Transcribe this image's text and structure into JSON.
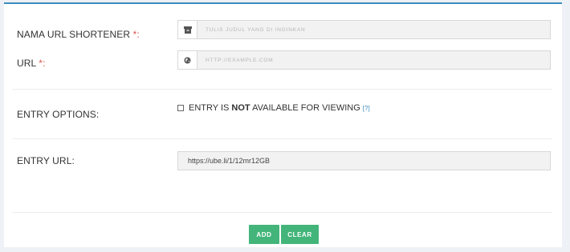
{
  "form": {
    "name_label": "NAMA URL SHORTENER ",
    "name_required": "*:",
    "name_placeholder": "TULIS JUDUL YANG DI INGINKAN",
    "name_icon": "archive-icon",
    "url_label": "URL ",
    "url_required": "*:",
    "url_placeholder": "HTTP://EXAMPLE.COM",
    "url_icon": "globe-icon",
    "entry_options_label": "ENTRY OPTIONS:",
    "entry_option_text_before": "ENTRY IS ",
    "entry_option_text_bold": "NOT",
    "entry_option_text_after": " AVAILABLE FOR VIEWING",
    "entry_option_help": "[?]",
    "entry_url_label": "ENTRY URL:",
    "entry_url_value": "https://ube.li/1/12mr12GB"
  },
  "buttons": {
    "add_label": "ADD",
    "clear_label": "CLEAR"
  },
  "colors": {
    "accent": "#3c8dbc",
    "button": "#43b57a",
    "required": "#d9534f"
  }
}
